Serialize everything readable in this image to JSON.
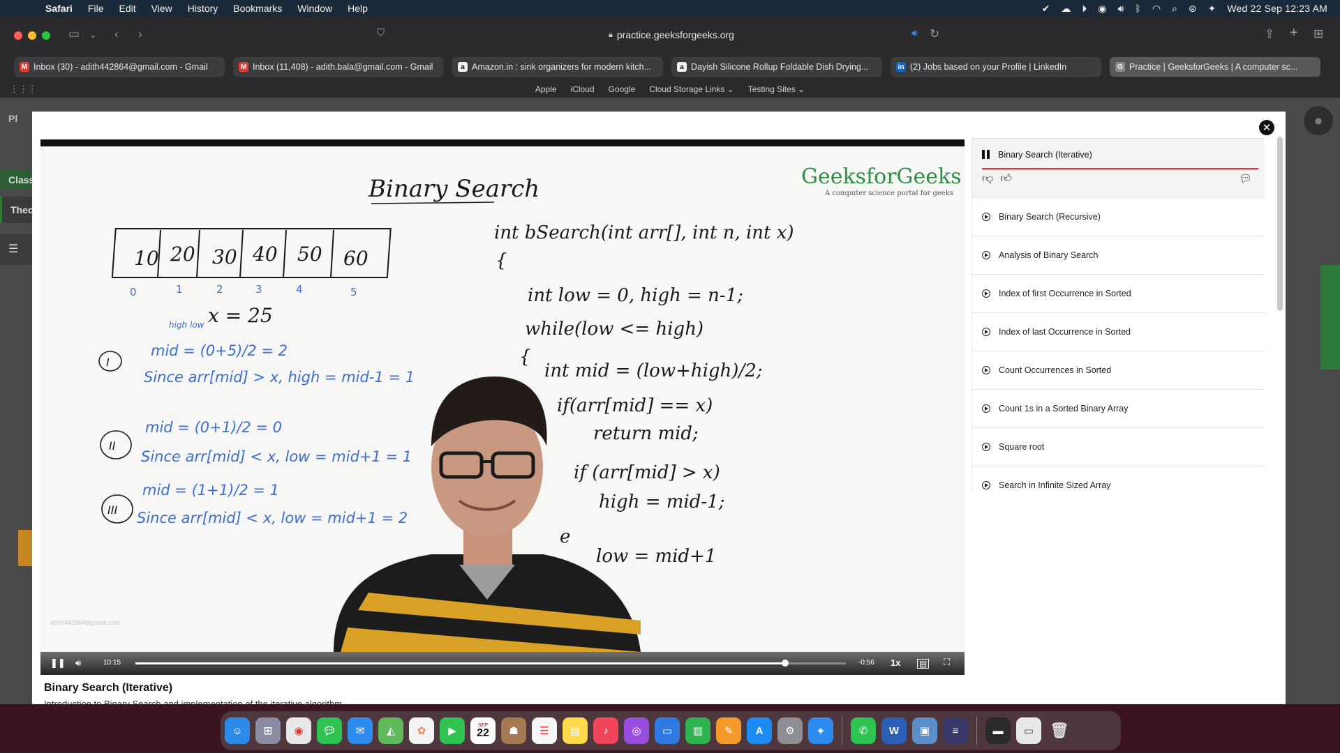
{
  "menubar": {
    "app_name": "Safari",
    "menus": [
      "File",
      "Edit",
      "View",
      "History",
      "Bookmarks",
      "Window",
      "Help"
    ],
    "datetime": "Wed 22 Sep  12:23 AM"
  },
  "browser": {
    "url": "practice.geeksforgeeks.org",
    "tabs": [
      {
        "title": "Inbox (30) - adith442864@gmail.com - Gmail",
        "favicon": "gmail-icon",
        "color": "#e23a32"
      },
      {
        "title": "Inbox (11,408) - adith.bala@gmail.com - Gmail",
        "favicon": "gmail-icon",
        "color": "#e23a32"
      },
      {
        "title": "Amazon.in : sink organizers for modern kitch...",
        "favicon": "amazon-icon",
        "color": "#222222"
      },
      {
        "title": "Dayish Silicone Rollup Foldable Dish Drying...",
        "favicon": "amazon-icon",
        "color": "#222222"
      },
      {
        "title": "(2) Jobs based on your Profile | LinkedIn",
        "favicon": "linkedin-icon",
        "color": "#0a66c2"
      },
      {
        "title": "Practice | GeeksforGeeks | A computer sc...",
        "favicon": "gfg-icon",
        "color": "#2f8d46"
      }
    ],
    "favorites": [
      "Apple",
      "iCloud",
      "Google",
      "Cloud Storage Links ⌄",
      "Testing Sites ⌄"
    ]
  },
  "background_page": {
    "left_labels": [
      "Pl",
      "Class",
      "Theo"
    ],
    "left_icon_glyph": "☰"
  },
  "video": {
    "logo": "GeeksforGeeks",
    "logo_tagline": "A computer science portal for geeks",
    "watermark": "adith442864@gmail.com",
    "elapsed": "10:15",
    "remaining": "-0:56",
    "speed": "1x",
    "progress": 0.915,
    "title": "Binary Search (Iterative)",
    "description": "Introduction to Binary Search and implementation of the iterative algorithm",
    "whiteboard": {
      "heading": "Binary Search",
      "array": [
        "10",
        "20",
        "30",
        "40",
        "50",
        "60"
      ],
      "indices": [
        "0",
        "1",
        "2",
        "3",
        "4",
        "5"
      ],
      "pointer_note": "high low",
      "x_value": "x = 25",
      "steps": [
        {
          "numeral": "I",
          "line1": "mid = (0+5)/2 = 2",
          "line2": "Since arr[mid] > x, high = mid-1 = 1"
        },
        {
          "numeral": "II",
          "line1": "mid = (0+1)/2 = 0",
          "line2": "Since arr[mid] < x, low = mid+1 = 1"
        },
        {
          "numeral": "III",
          "line1": "mid = (1+1)/2 = 1",
          "line2": "Since arr[mid] < x, low = mid+1 = 2"
        }
      ],
      "code": [
        "int bSearch(int arr[], int n, int x)",
        "{",
        "int low = 0, high = n-1;",
        "while(low <= high)",
        "{",
        "int mid = (low+high)/2;",
        "if(arr[mid] == x)",
        "return mid;",
        "if (arr[mid] > x)",
        "high = mid-1;",
        "e",
        "low = mid+1"
      ]
    }
  },
  "playlist": {
    "active": "Binary Search (Iterative)",
    "items": [
      "Binary Search (Recursive)",
      "Analysis of Binary Search",
      "Index of first Occurrence in Sorted",
      "Index of last Occurrence in Sorted",
      "Count Occurrences in Sorted",
      "Count 1s in a Sorted Binary Array",
      "Square root",
      "Search in Infinite Sized Array"
    ]
  },
  "dock": {
    "apps": [
      "Finder",
      "Launchpad",
      "Chrome",
      "Messages",
      "Mail",
      "Maps",
      "Photos",
      "FaceTime",
      "Calendar",
      "Contacts",
      "Reminders",
      "Notes",
      "Music",
      "Podcasts",
      "Keynote",
      "Numbers",
      "Pages",
      "App Store",
      "System Preferences",
      "Safari",
      "WhatsApp",
      "Word",
      "Preview",
      "Claquette",
      "Screenshots",
      "Downloads",
      "Trash"
    ],
    "calendar_month": "SEP",
    "calendar_day": "22"
  },
  "colors": {
    "gfg_green": "#2f8d46",
    "marker_blue": "#3b6fd4",
    "marker_black": "#1a1a1a",
    "progress_red": "#e0322a"
  }
}
